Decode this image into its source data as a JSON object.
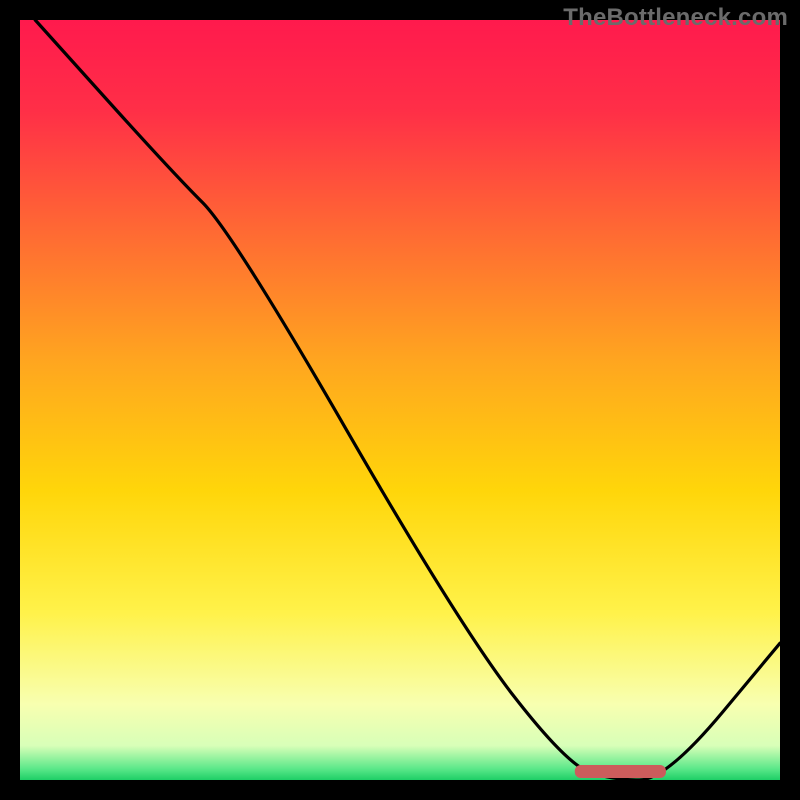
{
  "watermark": "TheBottleneck.com",
  "chart_data": {
    "type": "line",
    "title": "",
    "xlabel": "",
    "ylabel": "",
    "xlim": [
      0,
      100
    ],
    "ylim": [
      0,
      100
    ],
    "axes_visible": false,
    "background_gradient": {
      "stops": [
        {
          "offset": 0.0,
          "color": "#ff1a4d"
        },
        {
          "offset": 0.12,
          "color": "#ff2f47"
        },
        {
          "offset": 0.28,
          "color": "#ff6a33"
        },
        {
          "offset": 0.45,
          "color": "#ffa61f"
        },
        {
          "offset": 0.62,
          "color": "#ffd60a"
        },
        {
          "offset": 0.78,
          "color": "#fff24a"
        },
        {
          "offset": 0.9,
          "color": "#f8ffb0"
        },
        {
          "offset": 0.955,
          "color": "#d8ffb8"
        },
        {
          "offset": 0.985,
          "color": "#5ce88a"
        },
        {
          "offset": 1.0,
          "color": "#1ecf66"
        }
      ]
    },
    "series": [
      {
        "name": "bottleneck-curve",
        "points": [
          {
            "x": 2,
            "y": 100
          },
          {
            "x": 20,
            "y": 80
          },
          {
            "x": 28,
            "y": 72
          },
          {
            "x": 58,
            "y": 20
          },
          {
            "x": 72,
            "y": 2
          },
          {
            "x": 78,
            "y": 0
          },
          {
            "x": 85,
            "y": 0
          },
          {
            "x": 100,
            "y": 18
          }
        ]
      }
    ],
    "marker": {
      "x_start": 73,
      "x_end": 85,
      "y": 0,
      "color": "#cc5c5c"
    }
  }
}
